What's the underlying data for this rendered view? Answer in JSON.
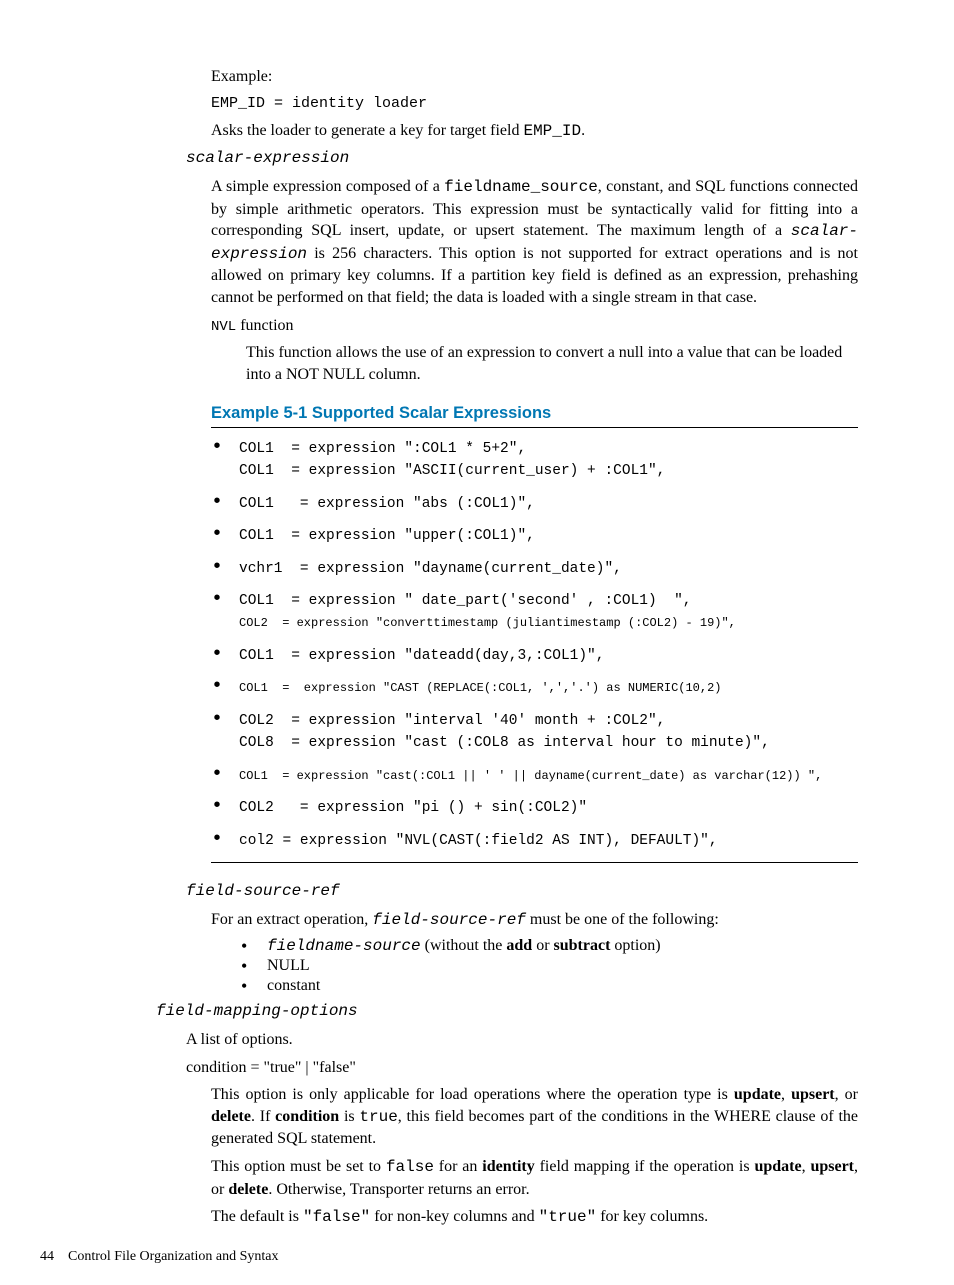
{
  "p_example_label": "Example:",
  "p_emp_line": "EMP_ID = identity loader",
  "p_asks_prefix": "Asks the loader to generate a key for target field ",
  "p_asks_code": "EMP_ID",
  "p_asks_suffix": ".",
  "scalar_expr_heading": "scalar-expression",
  "scalar_para_1a": "A simple expression composed of a ",
  "scalar_para_1b": "fieldname_source",
  "scalar_para_1c": ", constant, and SQL functions connected by simple arithmetic operators. This expression must be syntactically valid for fitting into a corresponding SQL insert, update, or upsert statement. The maximum length of a ",
  "scalar_para_1d": "scalar-expression",
  "scalar_para_1e": " is 256 characters. This option is not supported for extract operations and is not allowed on primary key columns. If a partition key field is defined as an expression, prehashing cannot be performed on that field; the data is loaded with a single stream in that case.",
  "nvl_label_code": "NVL",
  "nvl_label_rest": " function",
  "nvl_para": "This function allows the use of an expression to convert a null into a value that can be loaded into a NOT NULL column.",
  "example_title": "Example 5-1 Supported Scalar Expressions",
  "bullets": [
    {
      "main": "COL1  = expression \":COL1 * 5+2\",",
      "sub": "COL1  = expression \"ASCII(current_user) + :COL1\","
    },
    {
      "main": "COL1   = expression \"abs (:COL1)\","
    },
    {
      "main": "COL1  = expression \"upper(:COL1)\","
    },
    {
      "main": "vchr1  = expression \"dayname(current_date)\","
    },
    {
      "main": "COL1  = expression \" date_part('second' , :COL1)  \",",
      "subsmall": "COL2  = expression \"converttimestamp (juliantimestamp (:COL2) - 19)\","
    },
    {
      "main": "COL1  = expression \"dateadd(day,3,:COL1)\","
    },
    {
      "mainsmall": "COL1  =  expression \"CAST (REPLACE(:COL1, ',','.') as NUMERIC(10,2)"
    },
    {
      "main": "COL2  = expression \"interval '40' month + :COL2\",",
      "sub": "COL8  = expression \"cast (:COL8 as interval hour to minute)\","
    },
    {
      "mainsmall": "COL1  = expression \"cast(:COL1 || ' ' || dayname(current_date) as varchar(12)) \","
    },
    {
      "main": "COL2   = expression \"pi () + sin(:COL2)\""
    },
    {
      "main": "col2 = expression \"NVL(CAST(:field2 AS INT), DEFAULT)\","
    }
  ],
  "field_source_ref": "field-source-ref",
  "fsr_para_a": "For an extract operation, ",
  "fsr_para_b": "field-source-ref",
  "fsr_para_c": " must be one of the following:",
  "fsr_li1_code": "fieldname-source",
  "fsr_li1_a": " (without the ",
  "fsr_li1_b": "add",
  "fsr_li1_c": " or ",
  "fsr_li1_d": "subtract",
  "fsr_li1_e": " option)",
  "fsr_li2": "NULL",
  "fsr_li3": "constant",
  "field_mapping_options": "field-mapping-options",
  "fmo_desc": "A list of options.",
  "cond_heading": "condition = \"true\" | \"false\"",
  "cond_p1_a": "This option is only applicable for load operations where the operation type is ",
  "cond_p1_b": "update",
  "cond_p1_c": ", ",
  "cond_p1_d": "upsert",
  "cond_p1_e": ", or ",
  "cond_p1_f": "delete",
  "cond_p1_g": ". If ",
  "cond_p1_h": "condition",
  "cond_p1_i": " is ",
  "cond_p1_j": "true",
  "cond_p1_k": ", this field becomes part of the conditions in the WHERE clause of the generated SQL statement.",
  "cond_p2_a": "This option must be set to ",
  "cond_p2_b": "false",
  "cond_p2_c": " for an ",
  "cond_p2_d": "identity",
  "cond_p2_e": " field mapping if the operation is ",
  "cond_p2_f": "update",
  "cond_p2_g": ", ",
  "cond_p2_h": "upsert",
  "cond_p2_i": ", or ",
  "cond_p2_j": "delete",
  "cond_p2_k": ". Otherwise, Transporter returns an error.",
  "cond_p3_a": "The default is ",
  "cond_p3_b": "\"false\"",
  "cond_p3_c": " for non-key columns and ",
  "cond_p3_d": "\"true\"",
  "cond_p3_e": " for key columns.",
  "footer_page": "44",
  "footer_title": "Control File Organization and Syntax"
}
